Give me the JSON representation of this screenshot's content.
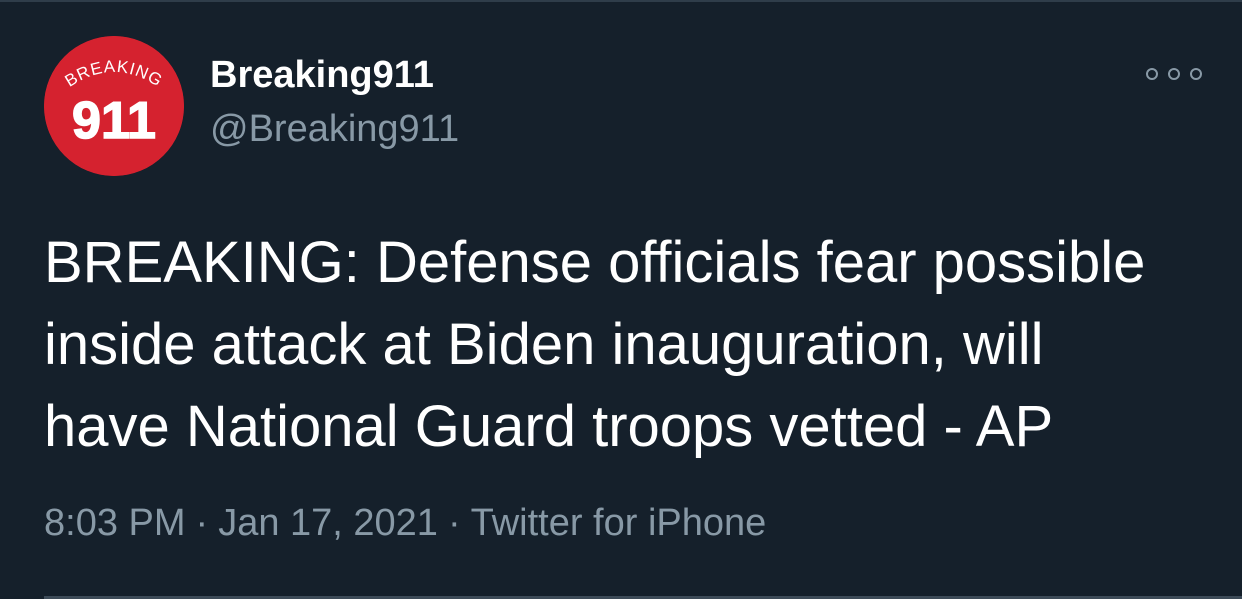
{
  "tweet": {
    "avatar": {
      "logo_text_top": "BREAKING",
      "logo_text_main": "911",
      "icon": "breaking911-logo"
    },
    "display_name": "Breaking911",
    "handle": "@Breaking911",
    "more_icon": "more-options-icon",
    "text_lines": [
      "BREAKING: Defense officials fear possible",
      "inside attack at Biden inauguration, will",
      "have National Guard troops vetted - AP"
    ],
    "time": "8:03 PM",
    "date": "Jan 17, 2021",
    "separator": "·",
    "source": "Twitter for iPhone"
  },
  "colors": {
    "background": "#15202b",
    "primary_text": "#ffffff",
    "secondary_text": "#8899a6",
    "logo_red": "#d5222f"
  }
}
